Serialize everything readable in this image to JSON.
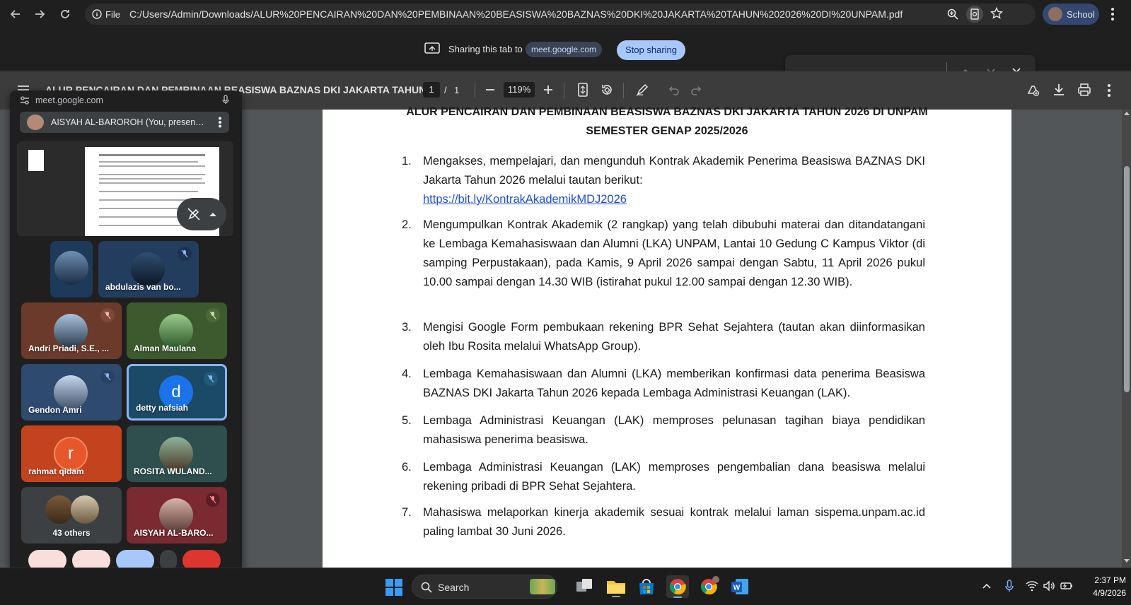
{
  "browser": {
    "file_label": "File",
    "url": "C:/Users/Admin/Downloads/ALUR%20PENCAIRAN%20DAN%20PEMBINAAN%20BEASISWA%20BAZNAS%20DKI%20JAKARTA%20TAHUN%202026%20DI%20UNPAM.pdf",
    "profile_label": "School"
  },
  "sharing": {
    "text": "Sharing this tab to",
    "domain": "meet.google.com",
    "stop_label": "Stop sharing"
  },
  "pdf": {
    "title": "ALUR PENCAIRAN DAN PEMBINAAN BEASISWA BAZNAS DKI JAKARTA TAHUN ...",
    "page_current": "1",
    "page_sep": "/",
    "page_total": "1",
    "zoom": "119%"
  },
  "document": {
    "title_line1": "ALUR PENCAIRAN DAN PEMBINAAN BEASISWA BAZNAS DKI JAKARTA TAHUN 2026 DI UNPAM",
    "title_line2": "SEMESTER GENAP 2025/2026",
    "items": [
      {
        "num": "1.",
        "text": "Mengakses, mempelajari, dan mengunduh Kontrak Akademik Penerima Beasiswa BAZNAS DKI Jakarta Tahun 2026 melalui tautan berikut:",
        "link": "https://bit.ly/KontrakAkademikMDJ2026"
      },
      {
        "num": "2.",
        "text": "Mengumpulkan Kontrak Akademik (2 rangkap) yang telah dibubuhi materai dan ditandatangani ke Lembaga Kemahasiswaan dan Alumni (LKA) UNPAM, Lantai 10 Gedung C Kampus Viktor (di samping Perpustakaan), pada Kamis, 9 April 2026 sampai dengan Sabtu, 11 April 2026 pukul 10.00 sampai dengan 14.30 WIB (istirahat pukul 12.00 sampai dengan 12.30 WIB)."
      },
      {
        "num": "3.",
        "text": "Mengisi Google Form pembukaan rekening BPR Sehat Sejahtera (tautan akan diinformasikan oleh Ibu Rosita melalui WhatsApp Group)."
      },
      {
        "num": "4.",
        "text": "Lembaga Kemahasiswaan dan Alumni (LKA) memberikan konfirmasi data penerima Beasiswa BAZNAS DKI Jakarta Tahun 2026 kepada Lembaga Administrasi Keuangan (LAK)."
      },
      {
        "num": "5.",
        "text": "Lembaga Administrasi Keuangan (LAK) memproses pelunasan tagihan biaya pendidikan mahasiswa penerima beasiswa."
      },
      {
        "num": "6.",
        "text": "Lembaga Administrasi Keuangan (LAK) memproses pengembalian dana beasiswa melalui rekening pribadi di BPR Sehat Sejahtera."
      },
      {
        "num": "7.",
        "text": "Mahasiswa melaporkan kinerja akademik sesuai kontrak melalui laman sispema.unpam.ac.id paling lambat 30 Juni 2026."
      }
    ]
  },
  "meet": {
    "url": "meet.google.com",
    "presenter": "AISYAH AL-BAROROH (You, presenting, ...",
    "participants": [
      {
        "name": "abdulazis van bo..."
      },
      {
        "name": "Andri Priadi, S.E., ..."
      },
      {
        "name": "Alman Maulana"
      },
      {
        "name": "Gendon Amri"
      },
      {
        "name": "detty nafsiah",
        "initial": "d"
      },
      {
        "name": "rahmat qidam",
        "initial": "r"
      },
      {
        "name": "ROSITA WULAND..."
      },
      {
        "name": "43 others"
      },
      {
        "name": "AISYAH AL-BARO..."
      }
    ]
  },
  "taskbar": {
    "search_label": "Search",
    "time": "2:37 PM",
    "date": "4/9/2026"
  },
  "colors": {
    "link": "#1f4ed8",
    "stop_button": "#a8c7fa",
    "active_tile_border": "#8ab4f8",
    "mic_off_red": "#ea4335"
  }
}
